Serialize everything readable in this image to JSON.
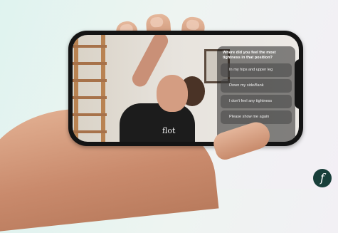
{
  "screen": {
    "question": "Where did you feel the most tightness in that position?",
    "options": [
      "In my hips and upper leg",
      "Down my side/flank",
      "I don't feel any tightness",
      "Please show me again"
    ],
    "shirt_logo": "flot"
  },
  "brand": {
    "logo": "f",
    "accent": "#183f3a"
  }
}
